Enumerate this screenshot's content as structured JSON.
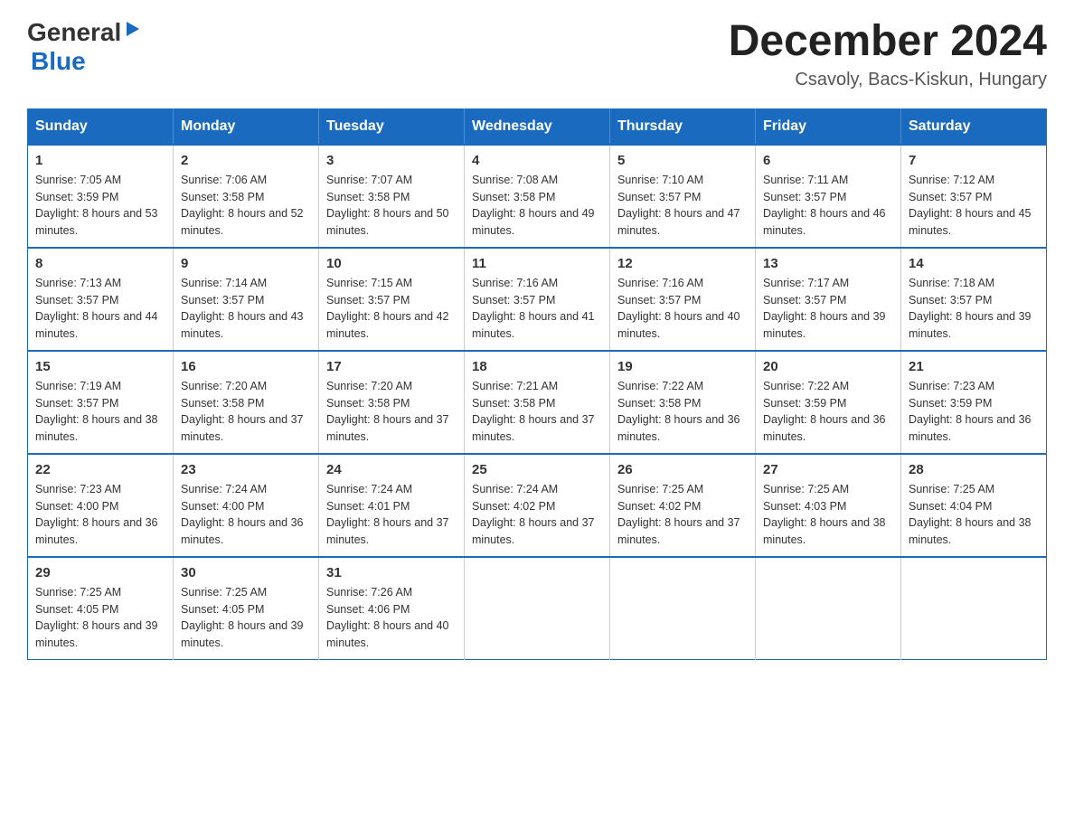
{
  "header": {
    "logo": {
      "general": "General",
      "blue": "Blue"
    },
    "title": "December 2024",
    "subtitle": "Csavoly, Bacs-Kiskun, Hungary"
  },
  "calendar": {
    "days_of_week": [
      "Sunday",
      "Monday",
      "Tuesday",
      "Wednesday",
      "Thursday",
      "Friday",
      "Saturday"
    ],
    "weeks": [
      [
        {
          "day": "1",
          "sunrise": "7:05 AM",
          "sunset": "3:59 PM",
          "daylight": "8 hours and 53 minutes."
        },
        {
          "day": "2",
          "sunrise": "7:06 AM",
          "sunset": "3:58 PM",
          "daylight": "8 hours and 52 minutes."
        },
        {
          "day": "3",
          "sunrise": "7:07 AM",
          "sunset": "3:58 PM",
          "daylight": "8 hours and 50 minutes."
        },
        {
          "day": "4",
          "sunrise": "7:08 AM",
          "sunset": "3:58 PM",
          "daylight": "8 hours and 49 minutes."
        },
        {
          "day": "5",
          "sunrise": "7:10 AM",
          "sunset": "3:57 PM",
          "daylight": "8 hours and 47 minutes."
        },
        {
          "day": "6",
          "sunrise": "7:11 AM",
          "sunset": "3:57 PM",
          "daylight": "8 hours and 46 minutes."
        },
        {
          "day": "7",
          "sunrise": "7:12 AM",
          "sunset": "3:57 PM",
          "daylight": "8 hours and 45 minutes."
        }
      ],
      [
        {
          "day": "8",
          "sunrise": "7:13 AM",
          "sunset": "3:57 PM",
          "daylight": "8 hours and 44 minutes."
        },
        {
          "day": "9",
          "sunrise": "7:14 AM",
          "sunset": "3:57 PM",
          "daylight": "8 hours and 43 minutes."
        },
        {
          "day": "10",
          "sunrise": "7:15 AM",
          "sunset": "3:57 PM",
          "daylight": "8 hours and 42 minutes."
        },
        {
          "day": "11",
          "sunrise": "7:16 AM",
          "sunset": "3:57 PM",
          "daylight": "8 hours and 41 minutes."
        },
        {
          "day": "12",
          "sunrise": "7:16 AM",
          "sunset": "3:57 PM",
          "daylight": "8 hours and 40 minutes."
        },
        {
          "day": "13",
          "sunrise": "7:17 AM",
          "sunset": "3:57 PM",
          "daylight": "8 hours and 39 minutes."
        },
        {
          "day": "14",
          "sunrise": "7:18 AM",
          "sunset": "3:57 PM",
          "daylight": "8 hours and 39 minutes."
        }
      ],
      [
        {
          "day": "15",
          "sunrise": "7:19 AM",
          "sunset": "3:57 PM",
          "daylight": "8 hours and 38 minutes."
        },
        {
          "day": "16",
          "sunrise": "7:20 AM",
          "sunset": "3:58 PM",
          "daylight": "8 hours and 37 minutes."
        },
        {
          "day": "17",
          "sunrise": "7:20 AM",
          "sunset": "3:58 PM",
          "daylight": "8 hours and 37 minutes."
        },
        {
          "day": "18",
          "sunrise": "7:21 AM",
          "sunset": "3:58 PM",
          "daylight": "8 hours and 37 minutes."
        },
        {
          "day": "19",
          "sunrise": "7:22 AM",
          "sunset": "3:58 PM",
          "daylight": "8 hours and 36 minutes."
        },
        {
          "day": "20",
          "sunrise": "7:22 AM",
          "sunset": "3:59 PM",
          "daylight": "8 hours and 36 minutes."
        },
        {
          "day": "21",
          "sunrise": "7:23 AM",
          "sunset": "3:59 PM",
          "daylight": "8 hours and 36 minutes."
        }
      ],
      [
        {
          "day": "22",
          "sunrise": "7:23 AM",
          "sunset": "4:00 PM",
          "daylight": "8 hours and 36 minutes."
        },
        {
          "day": "23",
          "sunrise": "7:24 AM",
          "sunset": "4:00 PM",
          "daylight": "8 hours and 36 minutes."
        },
        {
          "day": "24",
          "sunrise": "7:24 AM",
          "sunset": "4:01 PM",
          "daylight": "8 hours and 37 minutes."
        },
        {
          "day": "25",
          "sunrise": "7:24 AM",
          "sunset": "4:02 PM",
          "daylight": "8 hours and 37 minutes."
        },
        {
          "day": "26",
          "sunrise": "7:25 AM",
          "sunset": "4:02 PM",
          "daylight": "8 hours and 37 minutes."
        },
        {
          "day": "27",
          "sunrise": "7:25 AM",
          "sunset": "4:03 PM",
          "daylight": "8 hours and 38 minutes."
        },
        {
          "day": "28",
          "sunrise": "7:25 AM",
          "sunset": "4:04 PM",
          "daylight": "8 hours and 38 minutes."
        }
      ],
      [
        {
          "day": "29",
          "sunrise": "7:25 AM",
          "sunset": "4:05 PM",
          "daylight": "8 hours and 39 minutes."
        },
        {
          "day": "30",
          "sunrise": "7:25 AM",
          "sunset": "4:05 PM",
          "daylight": "8 hours and 39 minutes."
        },
        {
          "day": "31",
          "sunrise": "7:26 AM",
          "sunset": "4:06 PM",
          "daylight": "8 hours and 40 minutes."
        },
        null,
        null,
        null,
        null
      ]
    ]
  }
}
